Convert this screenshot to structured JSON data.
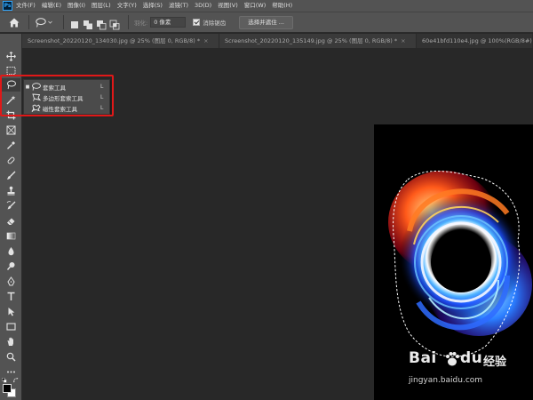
{
  "app": {
    "logo": "Ps"
  },
  "menu": [
    "文件(F)",
    "编辑(E)",
    "图像(I)",
    "图层(L)",
    "文字(Y)",
    "选择(S)",
    "滤镜(T)",
    "3D(D)",
    "视图(V)",
    "窗口(W)",
    "帮助(H)"
  ],
  "options": {
    "home_icon": "home-icon",
    "preset_icon": "lasso-icon",
    "feather_label": "羽化:",
    "feather_value": "0 像素",
    "antialias_label": "消除锯齿",
    "antialias_checked": true,
    "select_mask_label": "选择并遮住 ..."
  },
  "tabs": [
    {
      "label": "Screenshot_20220120_134030.jpg @ 25% (图层 0, RGB/8) *",
      "close": "×"
    },
    {
      "label": "Screenshot_20220120_135149.jpg @ 25% (图层 0, RGB/8) *",
      "close": "×"
    },
    {
      "label": "60e41bfd110e4.jpg @ 100%(RGB/8#)",
      "close": ""
    }
  ],
  "tools": [
    "move-icon",
    "marquee-icon",
    "lasso-icon",
    "magic-wand-icon",
    "crop-icon",
    "frame-icon",
    "eyedropper-icon",
    "healing-brush-icon",
    "brush-icon",
    "clone-stamp-icon",
    "history-brush-icon",
    "eraser-icon",
    "gradient-icon",
    "blur-icon",
    "dodge-icon",
    "pen-icon",
    "type-icon",
    "path-selection-icon",
    "rectangle-icon",
    "hand-icon",
    "zoom-icon",
    "more-tools-icon"
  ],
  "flyout": {
    "items": [
      {
        "label": "套索工具",
        "key": "L",
        "icon": "lasso-icon",
        "selected": true
      },
      {
        "label": "多边形套索工具",
        "key": "L",
        "icon": "polygonal-lasso-icon",
        "selected": false
      },
      {
        "label": "磁性套索工具",
        "key": "L",
        "icon": "magnetic-lasso-icon",
        "selected": false
      }
    ]
  },
  "colors": {
    "foreground": "#000000",
    "background": "#ffffff",
    "highlight": "#e01818"
  },
  "watermark": {
    "logo": "Bai",
    "logo_tail": "经验",
    "url": "jingyan.baidu.com"
  }
}
